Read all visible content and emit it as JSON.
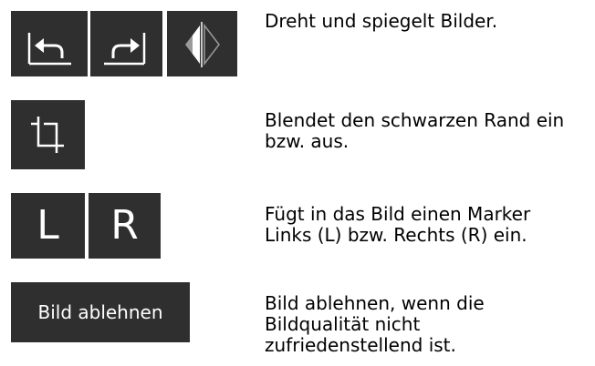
{
  "rows": [
    {
      "icons": [
        "rotate-left-icon",
        "rotate-right-icon",
        "flip-icon"
      ],
      "description": "Dreht und spiegelt Bilder."
    },
    {
      "icons": [
        "crop-icon"
      ],
      "description_line1": "Blendet den schwarzen Rand ein",
      "description_line2": "bzw. aus."
    },
    {
      "buttons": {
        "left": "L",
        "right": "R"
      },
      "description_line1": "Fügt in das Bild einen Marker",
      "description_line2": "Links (L) bzw. Rechts (R) ein."
    },
    {
      "button_label": "Bild ablehnen",
      "description_line1": "Bild ablehnen, wenn die",
      "description_line2": "Bildqualität nicht",
      "description_line3": "zufriedenstellend ist."
    }
  ],
  "colors": {
    "tile_background": "#2f2f2f",
    "icon_stroke": "#ffffff",
    "text": "#000000",
    "flip_gray": "#9a9a9a"
  }
}
